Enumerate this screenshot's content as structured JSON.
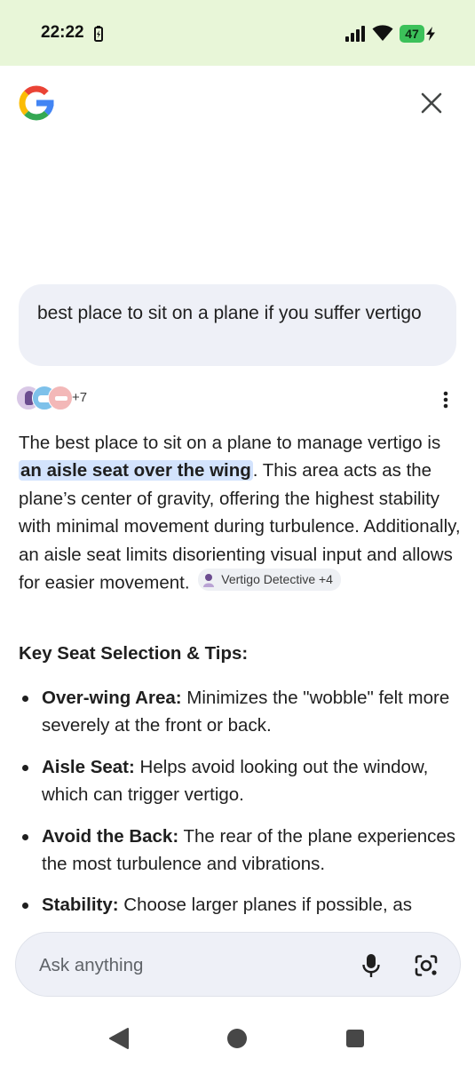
{
  "status_bar": {
    "time": "22:22",
    "battery_level": "47",
    "icons": [
      "battery-saver-icon",
      "signal-icon",
      "wifi-icon",
      "battery-icon",
      "charging-icon"
    ]
  },
  "header": {
    "logo_icon": "google-logo",
    "close_icon": "close-icon"
  },
  "query": {
    "text": "best place to sit on a plane if you suffer vertigo"
  },
  "sources": {
    "count_label": "+7"
  },
  "answer": {
    "intro_before": "The best place to sit on a plane to manage vertigo is ",
    "highlight": "an aisle seat over the wing",
    "intro_after": ". This area acts as the plane’s center of gravity, offering the highest stability with minimal movement during turbulence. Additionally, an aisle seat limits disorienting visual input and allows for easier movement.",
    "source_chip": "Vertigo Detective +4"
  },
  "tips": {
    "heading": "Key Seat Selection & Tips:",
    "items": [
      {
        "title": "Over-wing Area:",
        "text": " Minimizes the \"wobble\" felt more severely at the front or back."
      },
      {
        "title": "Aisle Seat:",
        "text": " Helps avoid looking out the window, which can trigger vertigo."
      },
      {
        "title": "Avoid the Back:",
        "text": " The rear of the plane experiences the most turbulence and vibrations."
      },
      {
        "title": "Stability:",
        "text": " Choose larger planes if possible, as"
      }
    ]
  },
  "ask_bar": {
    "placeholder": "Ask anything",
    "mic_icon": "mic-icon",
    "lens_icon": "lens-icon"
  },
  "nav_bar": {
    "icons": [
      "back-icon",
      "home-icon",
      "recents-icon"
    ]
  },
  "colors": {
    "status_bar_bg": "#e8f6d8",
    "query_bubble_bg": "#eef0f7",
    "highlight_bg": "#d3e3fd",
    "battery_green": "#3cc15a"
  }
}
